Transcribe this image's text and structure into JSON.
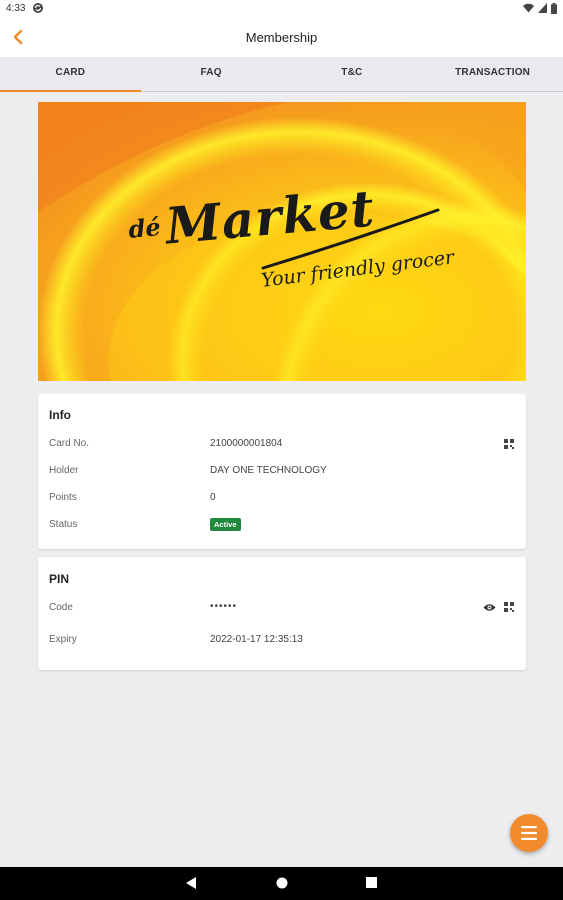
{
  "status_bar": {
    "time": "4:33"
  },
  "header": {
    "title": "Membership"
  },
  "tabs": [
    {
      "label": "CARD",
      "active": true
    },
    {
      "label": "FAQ",
      "active": false
    },
    {
      "label": "T&C",
      "active": false
    },
    {
      "label": "TRANSACTION",
      "active": false
    }
  ],
  "card": {
    "brand_prefix": "dé",
    "brand_name": "Market",
    "tagline": "Your friendly grocer"
  },
  "info": {
    "title": "Info",
    "card_no_label": "Card No.",
    "card_no_value": "2100000001804",
    "holder_label": "Holder",
    "holder_value": "DAY ONE TECHNOLOGY",
    "points_label": "Points",
    "points_value": "0",
    "status_label": "Status",
    "status_value": "Active"
  },
  "pin": {
    "title": "PIN",
    "code_label": "Code",
    "code_value": "••••••",
    "expiry_label": "Expiry",
    "expiry_value": "2022-01-17 12:35:13"
  },
  "colors": {
    "accent": "#f18a2c",
    "status_active": "#1f8a3b",
    "card_orange": "#f5a01e",
    "card_yellow": "#ffd400"
  },
  "icons": {
    "back": "chevron-left-icon",
    "qr": "qr-code-icon",
    "eye": "eye-icon",
    "menu": "menu-icon"
  }
}
